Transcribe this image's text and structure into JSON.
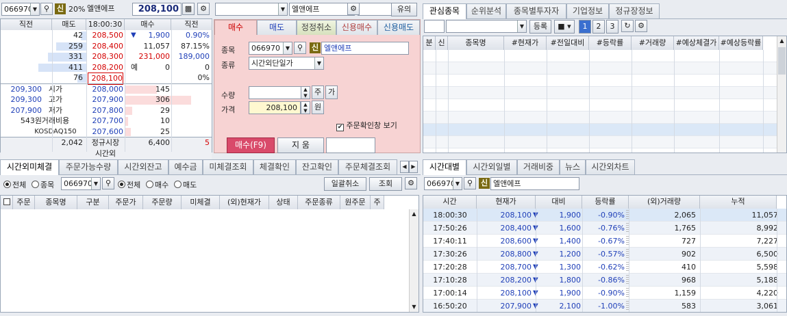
{
  "top_left": {
    "code": "066970",
    "sin": "신",
    "margin": "20%",
    "name": "엘앤에프",
    "price": "208,100"
  },
  "orderbook": {
    "headers": [
      "직전",
      "매도",
      "18:00:30",
      "매수",
      "직전"
    ],
    "asks": [
      {
        "qty": "42",
        "price": "208,500",
        "bar": 0.06
      },
      {
        "qty": "259",
        "price": "208,400",
        "bar": 0.35
      },
      {
        "qty": "331",
        "price": "208,300",
        "bar": 0.45
      },
      {
        "qty": "411",
        "price": "208,200",
        "bar": 0.56
      },
      {
        "qty": "76",
        "price": "208,100",
        "bar": 0.1
      }
    ],
    "info": {
      "change_sign": "▼",
      "change": "1,900",
      "change_rate": "0.90%",
      "volume": "11,057",
      "vol_rate": "87.15%",
      "prev_vol": "231,000",
      "prev_vol2": "189,000",
      "exp_label": "예",
      "exp_val": "0",
      "exp_val2": "0",
      "pct": "0%"
    },
    "left_labels": [
      {
        "val": "209,300",
        "label": "시가"
      },
      {
        "val": "209,300",
        "label": "고가"
      },
      {
        "val": "207,900",
        "label": "저가"
      },
      {
        "val": "543원",
        "label": "거래비용"
      },
      {
        "val": "",
        "label": "KOSDAQ150"
      }
    ],
    "bids": [
      {
        "price": "208,000",
        "qty": "145",
        "bar": 0.38
      },
      {
        "price": "207,900",
        "qty": "306",
        "bar": 0.8
      },
      {
        "price": "207,800",
        "qty": "29",
        "bar": 0.08
      },
      {
        "price": "207,700",
        "qty": "10",
        "bar": 0.03
      },
      {
        "price": "207,600",
        "qty": "25",
        "bar": 0.07
      }
    ],
    "footer": {
      "ask_total": "2,042",
      "market": "정규시장",
      "bid_total": "6,400",
      "diff": "5",
      "session": "시간외"
    }
  },
  "order_panel": {
    "top_input": "",
    "name": "엘앤에프",
    "notice_btn": "유의",
    "tabs": [
      "매수",
      "매도",
      "정정취소",
      "신용매수",
      "신용매도"
    ],
    "code_label": "종목",
    "code": "066970",
    "sin": "신",
    "stock_name": "엘앤에프",
    "type_label": "종류",
    "type_value": "시간외단일가",
    "qty_label": "수량",
    "qty_btn1": "주",
    "qty_btn2": "가",
    "price_label": "가격",
    "price_value": "208,100",
    "price_unit": "원",
    "confirm_label": "주문확인창 보기",
    "buy_btn": "매수(F9)",
    "clear_btn": "지 움"
  },
  "interest": {
    "tabs": [
      "관심종목",
      "순위분석",
      "종목별투자자",
      "기업정보",
      "정규장정보"
    ],
    "register_btn": "등록",
    "pages": [
      "1",
      "2",
      "3"
    ],
    "columns": [
      "분",
      "신",
      "종목명",
      "#현재가",
      "#전일대비",
      "#등락률",
      "#거래량",
      "#예상체결가",
      "#예상등락률"
    ]
  },
  "unfilled": {
    "tabs": [
      "시간외미체결",
      "주문가능수량",
      "시간외잔고",
      "예수금",
      "미체결조회",
      "체결확인",
      "잔고확인",
      "주문체결조회"
    ],
    "filter1": [
      "전체",
      "종목"
    ],
    "code": "066970",
    "filter2": [
      "전체",
      "매수",
      "매도"
    ],
    "cancel_all_btn": "일괄취소",
    "query_btn": "조회",
    "columns": [
      "주문",
      "종목명",
      "구분",
      "주문가",
      "주문량",
      "미체결",
      "(외)현재가",
      "상태",
      "주문종류",
      "원주문",
      "주"
    ]
  },
  "ticks": {
    "tabs": [
      "시간대별",
      "시간외일별",
      "거래비중",
      "뉴스",
      "시간외차트"
    ],
    "code": "066970",
    "sin": "신",
    "name": "엘앤에프",
    "columns": [
      "시간",
      "현재가",
      "대비",
      "등락률",
      "(외)거래량",
      "누적"
    ],
    "rows": [
      {
        "time": "18:00:30",
        "price": "208,100",
        "diff": "1,900",
        "rate": "-0.90%",
        "vol": "2,065",
        "cum": "11,057"
      },
      {
        "time": "17:50:26",
        "price": "208,400",
        "diff": "1,600",
        "rate": "-0.76%",
        "vol": "1,765",
        "cum": "8,992"
      },
      {
        "time": "17:40:11",
        "price": "208,600",
        "diff": "1,400",
        "rate": "-0.67%",
        "vol": "727",
        "cum": "7,227"
      },
      {
        "time": "17:30:26",
        "price": "208,800",
        "diff": "1,200",
        "rate": "-0.57%",
        "vol": "902",
        "cum": "6,500"
      },
      {
        "time": "17:20:28",
        "price": "208,700",
        "diff": "1,300",
        "rate": "-0.62%",
        "vol": "410",
        "cum": "5,598"
      },
      {
        "time": "17:10:28",
        "price": "208,200",
        "diff": "1,800",
        "rate": "-0.86%",
        "vol": "968",
        "cum": "5,188"
      },
      {
        "time": "17:00:14",
        "price": "208,100",
        "diff": "1,900",
        "rate": "-0.90%",
        "vol": "1,159",
        "cum": "4,220"
      },
      {
        "time": "16:50:20",
        "price": "207,900",
        "diff": "2,100",
        "rate": "-1.00%",
        "vol": "583",
        "cum": "3,061"
      }
    ]
  },
  "colors": {
    "ask_bar": "#d6e3f7",
    "bid_bar": "#fbdcdc",
    "order_bg": "#f7d3d3",
    "up": "#d40000",
    "down": "#1f3fb8",
    "buy_btn": "#d94a6a",
    "highlight": "#dbe8f7"
  }
}
